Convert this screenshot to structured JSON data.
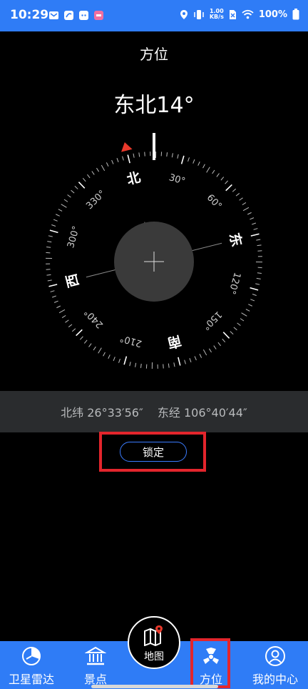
{
  "status_bar": {
    "time": "10:29",
    "speed_value": "1.00",
    "speed_unit": "KB/s",
    "battery": "100%",
    "left_icons": [
      "mail-icon",
      "app-icon",
      "cat-icon",
      "app-badge-icon"
    ],
    "right_icons": [
      "location-icon",
      "vibrate-icon",
      "sim-off-icon",
      "wifi-icon",
      "battery-icon"
    ]
  },
  "header": {
    "title": "方位"
  },
  "compass": {
    "heading_text": "东北14°",
    "heading_degrees": 14,
    "cardinals": {
      "north": "北",
      "east": "东",
      "south": "南",
      "west": "西"
    },
    "degree_labels": [
      "30°",
      "60°",
      "120°",
      "150°",
      "210°",
      "240°",
      "300°",
      "330°"
    ],
    "marker_color": "#e8392b"
  },
  "coordinates": {
    "latitude": "北纬 26°33′56″",
    "longitude": "东经 106°40′44″"
  },
  "lock_button": {
    "label": "锁定"
  },
  "bottom_nav": {
    "items": [
      {
        "label": "卫星雷达",
        "icon": "radar-icon"
      },
      {
        "label": "景点",
        "icon": "landmark-icon"
      },
      {
        "label": "地图",
        "icon": "map-icon"
      },
      {
        "label": "方位",
        "icon": "compass-nav-icon"
      },
      {
        "label": "我的中心",
        "icon": "user-icon"
      }
    ]
  },
  "colors": {
    "primary": "#2f7cf6",
    "highlight": "#e3252c",
    "band": "#2a2c2e",
    "button_border": "#3b7cff"
  }
}
